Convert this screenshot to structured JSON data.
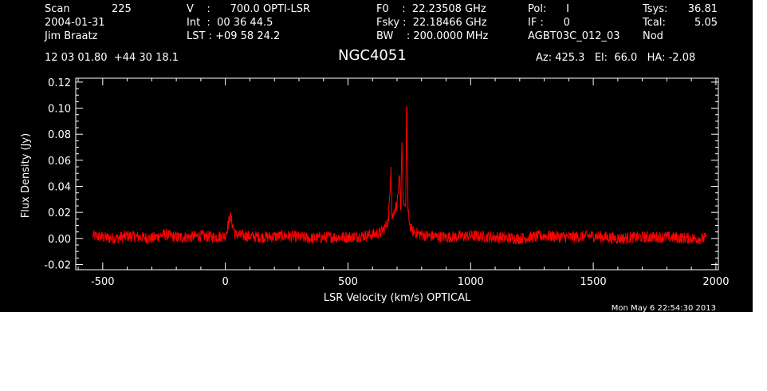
{
  "header": {
    "scan_label": "Scan",
    "scan_value": "225",
    "date": "2004-01-31",
    "observer": "Jim Braatz",
    "v_line": "V    :      700.0 OPTI-LSR",
    "int_line": "Int  :  00 36 44.5",
    "lst_line": "LST : +09 58 24.2",
    "f0_line": "F0    :  22.23508 GHz",
    "fsky_line": "Fsky :  22.18466 GHz",
    "bw_line": "BW    : 200.0000 MHz",
    "pol_line": "Pol:      I",
    "if_line": "IF :      0",
    "proj_line": "AGBT03C_012_03",
    "tsys_label": "Tsys:",
    "tsys_value": "36.81",
    "tcal_label": "Tcal:",
    "tcal_value": "5.05",
    "mode": "Nod",
    "coords": "12 03 01.80  +44 30 18.1",
    "source": "NGC4051",
    "pointing": "Az: 425.3   El:  66.0   HA: -2.08",
    "timestamp": "Mon May  6 22:54:30 2013"
  },
  "colors": {
    "background": "#000000",
    "axes": "#ffffff",
    "trace": "#ff0000"
  },
  "chart_data": {
    "type": "line",
    "xlabel": "LSR Velocity (km/s) OPTICAL",
    "ylabel": "Flux Density (Jy)",
    "xlim": [
      -610,
      2010
    ],
    "ylim": [
      -0.024,
      0.123
    ],
    "xticks": [
      -500,
      0,
      500,
      1000,
      1500,
      2000
    ],
    "xtick_labels": [
      "-500",
      "0",
      "500",
      "1000",
      "1500",
      "2000"
    ],
    "yticks": [
      -0.02,
      0.0,
      0.02,
      0.04,
      0.06,
      0.08,
      0.1,
      0.12
    ],
    "ytick_labels": [
      "-0.02",
      "0.00",
      "0.02",
      "0.04",
      "0.06",
      "0.08",
      "0.10",
      "0.12"
    ],
    "series": [
      {
        "values_x": [
          -540,
          -500,
          -450,
          -400,
          -350,
          -300,
          -250,
          -200,
          -150,
          -100,
          -50,
          0,
          20,
          40,
          80,
          150,
          250,
          350,
          420,
          500,
          560,
          600,
          630,
          650,
          665,
          675,
          680,
          690,
          700,
          710,
          715,
          720,
          725,
          730,
          735,
          740,
          745,
          750,
          760,
          780,
          820,
          900,
          1000,
          1100,
          1200,
          1300,
          1400,
          1500,
          1600,
          1700,
          1800,
          1900,
          1960
        ],
        "values": [
          0.002,
          0.001,
          0.0,
          0.002,
          0.001,
          0.0,
          0.003,
          0.001,
          0.001,
          0.002,
          0.001,
          0.002,
          0.017,
          0.003,
          0.002,
          0.001,
          0.002,
          0.0,
          0.001,
          0.001,
          0.002,
          0.003,
          0.004,
          0.008,
          0.014,
          0.055,
          0.015,
          0.022,
          0.026,
          0.048,
          0.022,
          0.074,
          0.03,
          0.026,
          0.024,
          0.101,
          0.02,
          0.012,
          0.006,
          0.004,
          0.002,
          0.001,
          0.002,
          0.001,
          0.0,
          0.002,
          0.001,
          0.002,
          0.0,
          0.001,
          0.001,
          0.0,
          0.0
        ]
      }
    ],
    "grid": false
  }
}
